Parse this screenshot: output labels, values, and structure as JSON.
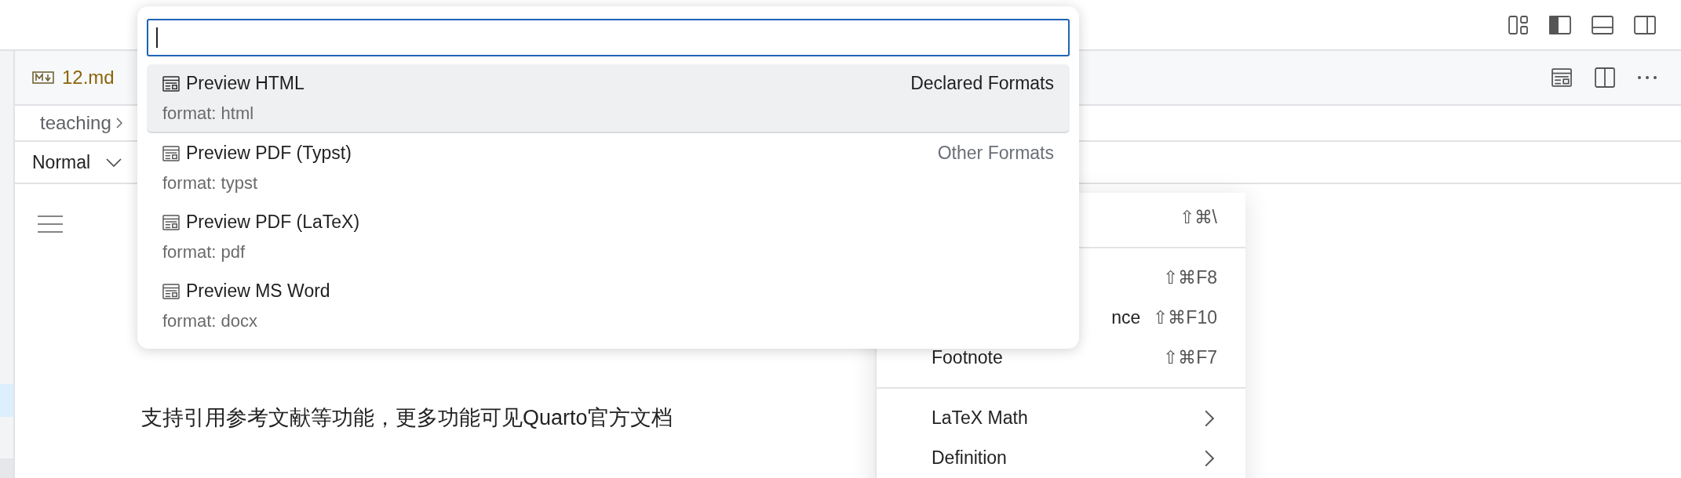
{
  "editor_tab": {
    "label": "12.md"
  },
  "breadcrumb": {
    "label": "teaching"
  },
  "toolbar": {
    "block_style": "Normal"
  },
  "document": {
    "paragraph": "支持引用参考文献等功能，更多功能可见Quarto官方文档"
  },
  "quick_pick": {
    "items": [
      {
        "label": "Preview HTML",
        "description": "format: html",
        "group": "Declared Formats",
        "selected": true
      },
      {
        "label": "Preview PDF (Typst)",
        "description": "format: typst",
        "group": "Other Formats",
        "selected": false
      },
      {
        "label": "Preview PDF (LaTeX)",
        "description": "format: pdf",
        "selected": false
      },
      {
        "label": "Preview MS Word",
        "description": "format: docx",
        "selected": false
      }
    ]
  },
  "context_menu": {
    "items": [
      {
        "kind": "item",
        "shortcut": "⇧⌘\\"
      },
      {
        "kind": "separator"
      },
      {
        "kind": "item",
        "shortcut": "⇧⌘F8"
      },
      {
        "kind": "cut_item",
        "label": "nce",
        "shortcut": "⇧⌘F10"
      },
      {
        "kind": "item",
        "label": "Footnote",
        "shortcut": "⇧⌘F7"
      },
      {
        "kind": "separator"
      },
      {
        "kind": "submenu",
        "label": "LaTeX Math"
      },
      {
        "kind": "submenu",
        "label": "Definition"
      }
    ]
  }
}
